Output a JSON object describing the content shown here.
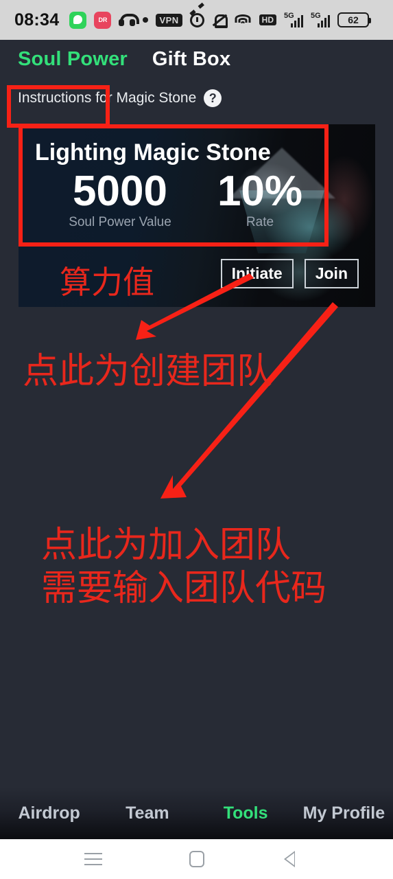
{
  "status_bar": {
    "time": "08:34",
    "icons": [
      "wechat-icon",
      "red-app-icon",
      "headset-icon",
      "dot-icon",
      "vpn-badge",
      "alarm-icon",
      "bell-muted-icon",
      "wifi-icon",
      "hd-badge",
      "signal-5g-1",
      "signal-5g-2",
      "battery-icon"
    ],
    "vpn_label": "VPN",
    "hd_label": "HD",
    "network_label_1": "5G",
    "network_label_2": "5G",
    "battery_level": "62"
  },
  "tabs": [
    {
      "label": "Soul Power",
      "active": true
    },
    {
      "label": "Gift Box",
      "active": false
    }
  ],
  "subheader": {
    "text": "Instructions for Magic Stone",
    "help_icon": "?"
  },
  "card": {
    "title": "Lighting Magic Stone",
    "stats": [
      {
        "value": "5000",
        "label": "Soul Power Value"
      },
      {
        "value": "10%",
        "label": "Rate"
      }
    ],
    "buttons": [
      {
        "label": "Initiate"
      },
      {
        "label": "Join"
      }
    ],
    "overlay_note": "算力值"
  },
  "annotations": {
    "accent_color": "#f72116",
    "text_color": "#e8271c",
    "line_1": "点此为创建团队",
    "line_2": "点此为加入团队",
    "line_3": "需要输入团队代码",
    "boxes": [
      "soul-power-tab-highlight",
      "magic-stone-stats-highlight"
    ],
    "arrows": [
      "initiate-button-arrow",
      "join-button-arrow"
    ]
  },
  "bottom_nav": [
    {
      "label": "Airdrop",
      "active": false
    },
    {
      "label": "Team",
      "active": false
    },
    {
      "label": "Tools",
      "active": true
    },
    {
      "label": "My Profile",
      "active": false
    }
  ],
  "android_nav": [
    "recents-icon",
    "home-icon",
    "back-icon"
  ],
  "colors": {
    "accent_green": "#33e07a",
    "annotation_red": "#f72116",
    "app_background": "#272b35"
  }
}
